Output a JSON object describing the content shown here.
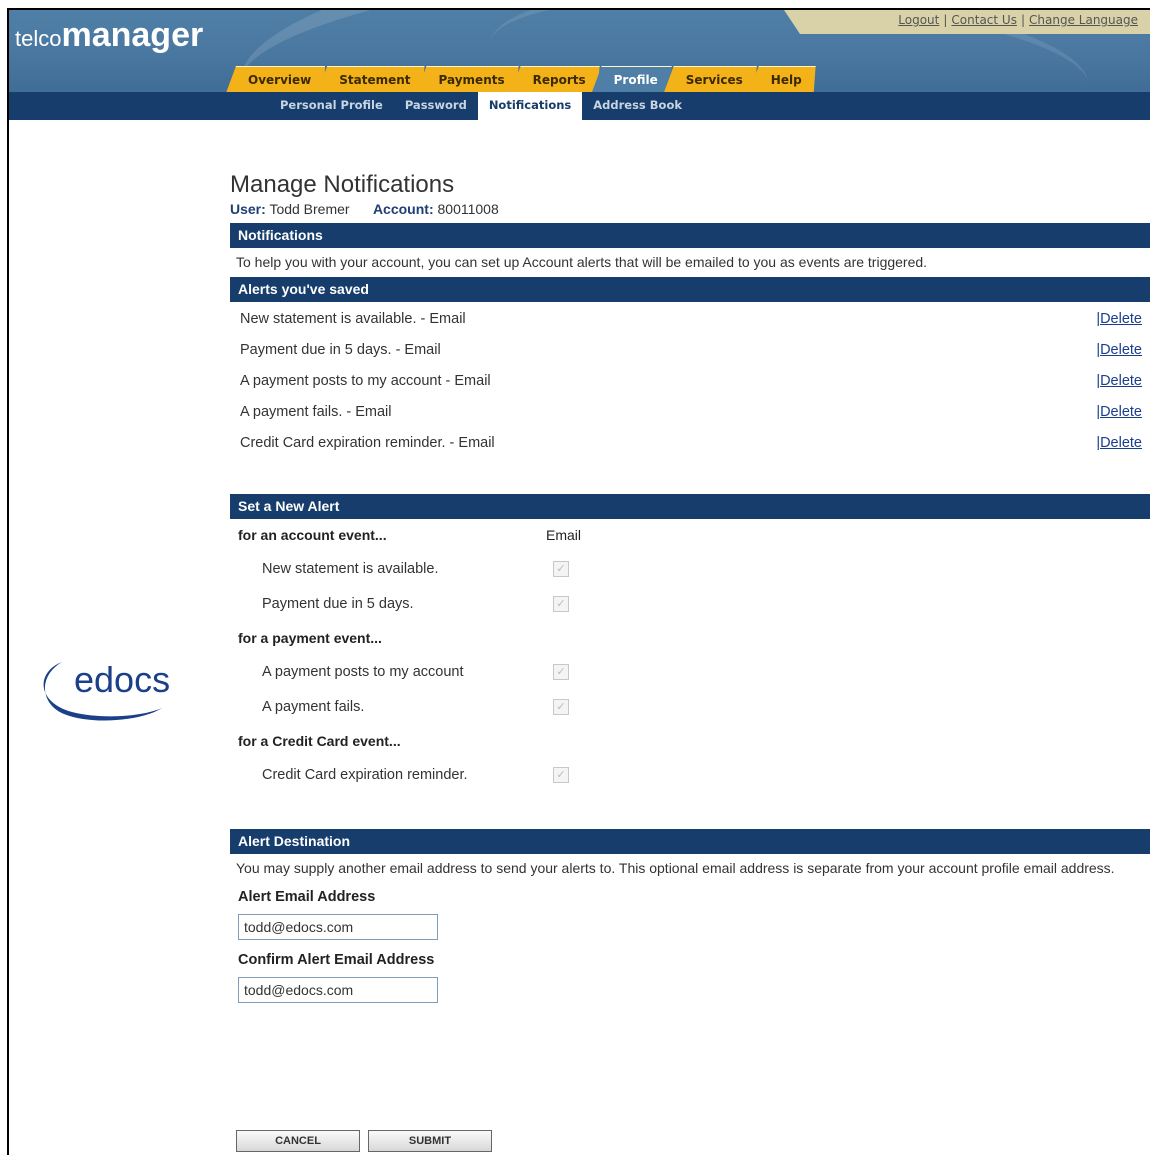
{
  "header": {
    "logo_small": "telco",
    "logo_big": "manager",
    "util_links": [
      "Logout",
      "Contact Us",
      "Change Language"
    ],
    "util_sep": "|",
    "tabs": [
      "Overview",
      "Statement",
      "Payments",
      "Reports",
      "Profile",
      "Services",
      "Help"
    ],
    "active_tab": "Profile"
  },
  "subnav": {
    "items": [
      "Personal Profile",
      "Password",
      "Notifications",
      "Address Book"
    ],
    "active": "Notifications"
  },
  "page": {
    "title": "Manage Notifications",
    "user_label": "User:",
    "user_name": "Todd Bremer",
    "account_label": "Account:",
    "account_number": "80011008"
  },
  "notifications": {
    "header": "Notifications",
    "text": "To help you with your account, you can set up Account alerts that will be emailed to you as events are triggered."
  },
  "saved_alerts": {
    "header": "Alerts you've saved",
    "delete_label": "|Delete",
    "items": [
      "New statement is available. - Email",
      "Payment due in 5 days. - Email",
      "A payment posts to my account - Email",
      "A payment fails. - Email",
      "Credit Card expiration reminder. - Email"
    ]
  },
  "new_alert": {
    "header": "Set a New Alert",
    "email_col": "Email",
    "groups": [
      {
        "title": "for an account event...",
        "options": [
          "New statement is available.",
          "Payment due in 5 days."
        ]
      },
      {
        "title": "for a payment event...",
        "options": [
          "A payment posts to my account",
          "A payment fails."
        ]
      },
      {
        "title": "for a Credit Card event...",
        "options": [
          "Credit Card expiration reminder."
        ]
      }
    ]
  },
  "destination": {
    "header": "Alert Destination",
    "text": "You may supply another email address to send your alerts to. This optional email address is separate from your account profile email address.",
    "email_label": "Alert Email Address",
    "email_value": "todd@edocs.com",
    "confirm_label": "Confirm Alert Email Address",
    "confirm_value": "todd@edocs.com"
  },
  "buttons": {
    "cancel": "CANCEL",
    "submit": "SUBMIT"
  },
  "brand": {
    "edocs": "edocs"
  },
  "colors": {
    "navy": "#163d6b",
    "tab_gold": "#f3b218",
    "header_blue": "#4f7fa6",
    "link": "#1a3e8c"
  }
}
